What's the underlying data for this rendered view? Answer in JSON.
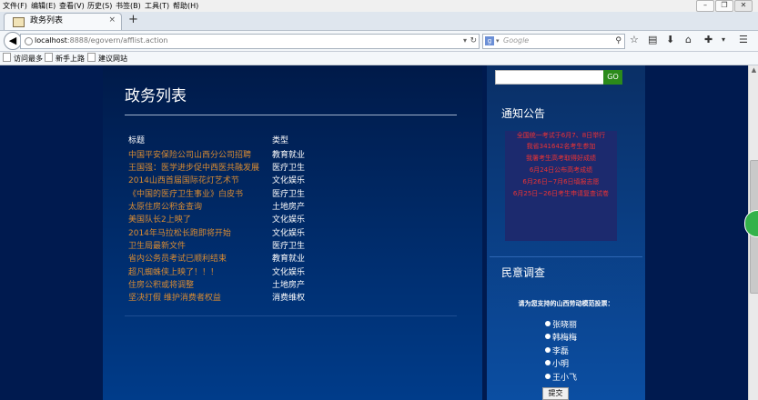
{
  "browser": {
    "menus": [
      "文件(F)",
      "编辑(E)",
      "查看(V)",
      "历史(S)",
      "书签(B)",
      "工具(T)",
      "帮助(H)"
    ],
    "window_controls": [
      "minimize",
      "restore",
      "close"
    ],
    "tab": {
      "title": "政务列表",
      "close": "×"
    },
    "new_tab": "+",
    "url": {
      "host": "localhost",
      "path": ":8888/egovern/afflist.action"
    },
    "search": {
      "engine": "g",
      "placeholder": "Google"
    },
    "bookmarks": [
      "访问最多",
      "新手上路",
      "建议网站"
    ],
    "icons": [
      "back-icon",
      "reload-icon",
      "search-icon",
      "star-icon",
      "bookmarks-list-icon",
      "download-icon",
      "home-icon",
      "addon-icon",
      "menu-icon"
    ]
  },
  "page": {
    "title": "政务列表",
    "table": {
      "headers": {
        "title": "标题",
        "type": "类型"
      },
      "rows": [
        {
          "title": "中国平安保险公司山西分公司招聘",
          "type": "教育就业"
        },
        {
          "title": "王国强：医学进步促中西医共融发展",
          "type": "医疗卫生"
        },
        {
          "title": "2014山西首届国际花灯艺术节",
          "type": "文化娱乐"
        },
        {
          "title": "《中国的医疗卫生事业》白皮书",
          "type": "医疗卫生"
        },
        {
          "title": "太原住房公积金查询",
          "type": "土地房产"
        },
        {
          "title": "美国队长2上映了",
          "type": "文化娱乐"
        },
        {
          "title": "2014年马拉松长跑即将开始",
          "type": "文化娱乐"
        },
        {
          "title": "卫生局最新文件",
          "type": "医疗卫生"
        },
        {
          "title": "省内公务员考试已顺利结束",
          "type": "教育就业"
        },
        {
          "title": "超凡蜘蛛侠上映了！！！",
          "type": "文化娱乐"
        },
        {
          "title": "住房公积或将调整",
          "type": "土地房产"
        },
        {
          "title": "坚决打假 维护消费者权益",
          "type": "消费维权"
        }
      ]
    },
    "sidebar": {
      "search_go": "GO",
      "notice_title": "通知公告",
      "notices": [
        "全国统一考试于6月7、8日举行",
        "我省341642名考生参加",
        "我署考生高考取得好成绩",
        "6月24日公布高考成绩",
        "6月26日~7月6日填报志愿",
        "6月25日~26日考生申请复查试卷"
      ],
      "survey_title": "民意调查",
      "survey_question": "请为您支持的山西劳动模范投票：",
      "options": [
        "张晓丽",
        "韩梅梅",
        "李磊",
        "小明",
        "王小飞"
      ],
      "submit": "提交"
    }
  }
}
